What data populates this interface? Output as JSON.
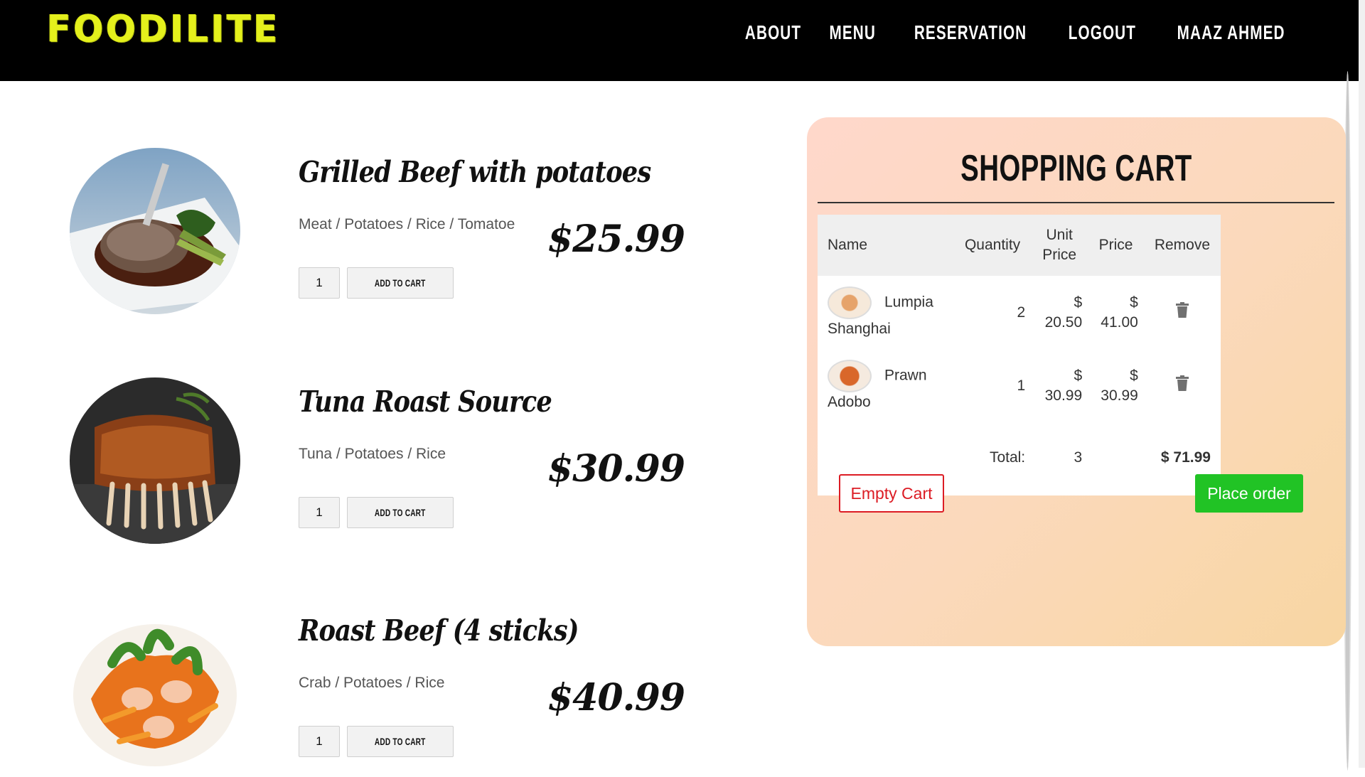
{
  "brand": {
    "logo": "FOODILITE",
    "logo_color": "#e4f01c"
  },
  "nav": {
    "items": [
      "ABOUT",
      "MENU",
      "RESERVATION",
      "LOGOUT",
      "MAAZ AHMED"
    ]
  },
  "menu": {
    "items": [
      {
        "name": "Grilled Beef with potatoes",
        "ingredients": "Meat / Potatoes / Rice / Tomatoe",
        "price": "$25.99",
        "quantity": "1",
        "add_label": "ADD TO CART",
        "image": "grilled-beef"
      },
      {
        "name": "Tuna Roast Source",
        "ingredients": "Tuna / Potatoes / Rice",
        "price": "$30.99",
        "quantity": "1",
        "add_label": "ADD TO CART",
        "image": "roast-ribs"
      },
      {
        "name": "Roast Beef (4 sticks)",
        "ingredients": "Crab / Potatoes / Rice",
        "price": "$40.99",
        "quantity": "1",
        "add_label": "ADD TO CART",
        "image": "shrimp-salad"
      }
    ]
  },
  "cart": {
    "title": "SHOPPING CART",
    "columns": {
      "name": "Name",
      "quantity": "Quantity",
      "unit_price": "Unit Price",
      "price": "Price",
      "remove": "Remove"
    },
    "rows": [
      {
        "name": "Lumpia Shanghai",
        "quantity": "2",
        "unit_currency": "$",
        "unit_price": "20.50",
        "price_currency": "$",
        "price": "41.00",
        "remove_icon": "trash-icon"
      },
      {
        "name": "Prawn Adobo",
        "quantity": "1",
        "unit_currency": "$",
        "unit_price": "30.99",
        "price_currency": "$",
        "price": "30.99",
        "remove_icon": "trash-icon"
      }
    ],
    "total_label": "Total:",
    "total_quantity": "3",
    "total_amount": "$ 71.99",
    "empty_label": "Empty Cart",
    "place_label": "Place order",
    "accent_danger": "#dc1c24",
    "accent_success": "#21c325"
  }
}
